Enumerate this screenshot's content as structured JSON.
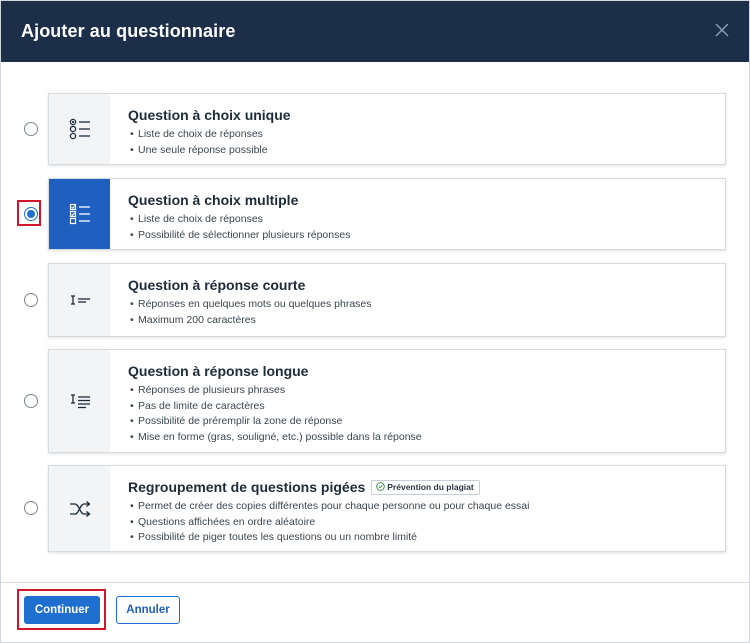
{
  "dialog": {
    "title": "Ajouter au questionnaire",
    "close_icon": "close-icon"
  },
  "options": [
    {
      "title": "Question à choix unique",
      "icon": "single-choice-list-icon",
      "selected": false,
      "bullets": [
        "Liste de choix de réponses",
        "Une seule réponse possible"
      ]
    },
    {
      "title": "Question à choix multiple",
      "icon": "multiple-choice-list-icon",
      "selected": true,
      "bullets": [
        "Liste de choix de réponses",
        "Possibilité de sélectionner plusieurs réponses"
      ]
    },
    {
      "title": "Question à réponse courte",
      "icon": "short-answer-icon",
      "selected": false,
      "bullets": [
        "Réponses en quelques mots ou quelques phrases",
        "Maximum 200 caractères"
      ]
    },
    {
      "title": "Question à réponse longue",
      "icon": "long-answer-icon",
      "selected": false,
      "bullets": [
        "Réponses de plusieurs phrases",
        "Pas de limite de caractères",
        "Possibilité de préremplir la zone de réponse",
        "Mise en forme (gras, souligné, etc.) possible dans la réponse"
      ]
    },
    {
      "title": "Regroupement de questions pigées",
      "icon": "shuffle-icon",
      "selected": false,
      "badge": "Prévention du plagiat",
      "badge_icon": "shield-check-icon",
      "bullets": [
        "Permet de créer des copies différentes pour chaque personne ou pour chaque essai",
        "Questions affichées en ordre aléatoire",
        "Possibilité de piger toutes les questions ou un nombre limité"
      ]
    }
  ],
  "footer": {
    "continue_label": "Continuer",
    "cancel_label": "Annuler"
  },
  "colors": {
    "header_bg": "#1c2e48",
    "accent": "#1f6fd1",
    "highlight": "#d3152b"
  }
}
